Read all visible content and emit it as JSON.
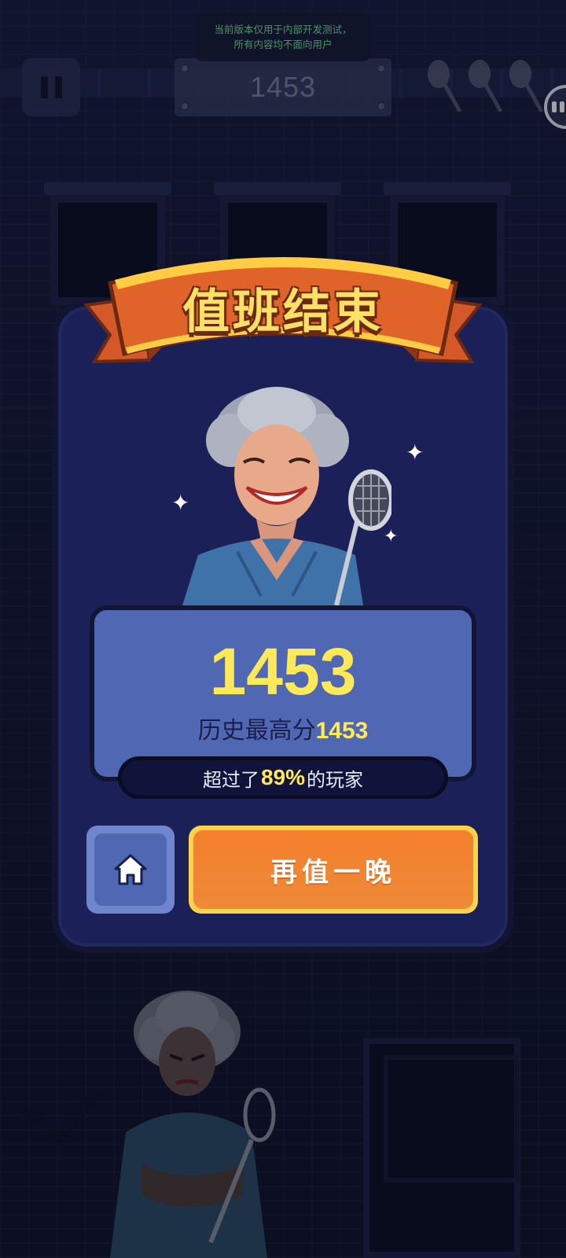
{
  "hud": {
    "score": "1453",
    "dev_notice_line1": "当前版本仅用于内部开发测试，",
    "dev_notice_line2": "所有内容均不面向用户",
    "lives_icon": "badminton-racket-icon",
    "lives_count": 3
  },
  "result": {
    "title": "值班结束",
    "score": "1453",
    "best_label": "历史最高分",
    "best_score": "1453",
    "percent_prefix": "超过了",
    "percent_value": "89%",
    "percent_suffix": "的玩家",
    "home_icon": "home-icon",
    "replay_label": "再值一晚"
  },
  "colors": {
    "accent_yellow": "#ffe957",
    "ribbon_orange": "#e0642a",
    "panel_navy": "#1c2058",
    "score_box_blue": "#5068b4",
    "replay_orange": "#f47f2c",
    "dev_notice_green": "#7be39a"
  }
}
